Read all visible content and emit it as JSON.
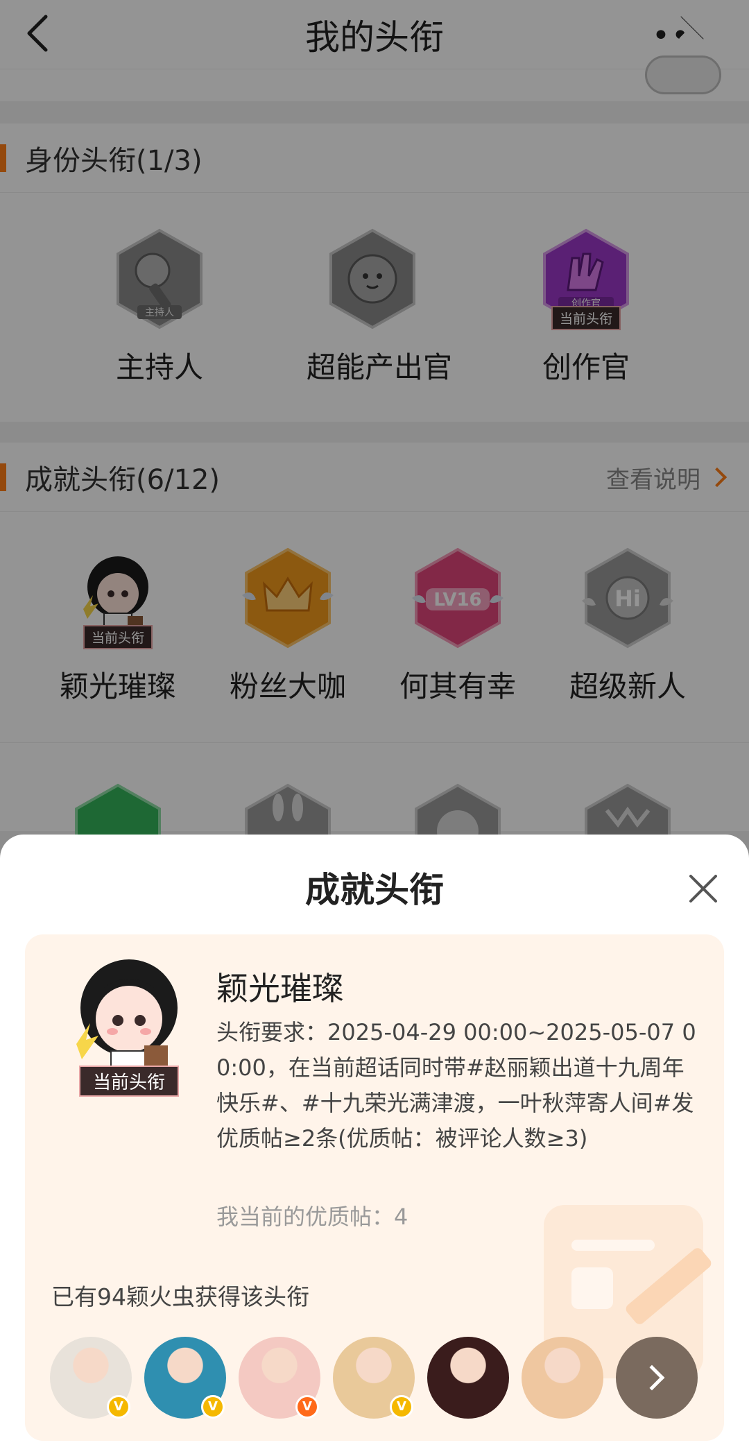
{
  "header": {
    "title": "我的头衔",
    "more_dots": "••"
  },
  "identity": {
    "title": "身份头衔(1/3)",
    "badges": [
      {
        "label": "主持人",
        "sub": "主持人",
        "icon": "microphone-badge-icon",
        "color": "#8a8a8a"
      },
      {
        "label": "超能产出官",
        "icon": "creature-badge-icon",
        "color": "#8a8a8a"
      },
      {
        "label": "创作官",
        "sub": "创作官",
        "icon": "hand-pen-badge-icon",
        "color": "#9b37c9",
        "current": "当前头衔"
      }
    ]
  },
  "achievement": {
    "title": "成就头衔(6/12)",
    "link": "查看说明",
    "badges": [
      {
        "label": "颖光璀璨",
        "icon": "cartoon-girl-avatar",
        "current": "当前头衔"
      },
      {
        "label": "粉丝大咖",
        "icon": "crown-badge-icon",
        "color": "#f29a1c"
      },
      {
        "label": "何其有幸",
        "text": "LV16",
        "icon": "lv16-badge-icon",
        "color": "#e0457b"
      },
      {
        "label": "超级新人",
        "text": "Hi",
        "icon": "hi-badge-icon",
        "color": "#9a9a9a"
      }
    ],
    "row2_icons": [
      "green-hand-badge-icon",
      "rabbit-badge-icon",
      "cartoon-head-badge-icon",
      "dragon-badge-icon"
    ]
  },
  "sheet": {
    "title": "成就头衔",
    "card": {
      "name": "颖光璀璨",
      "current": "当前头衔",
      "requirement": "头衔要求：2025-04-29 00:00~2025-05-07 00:00，在当前超话同时带#赵丽颖出道十九周年快乐#、#十九荣光满津渡，一叶秋萍寄人间#发优质帖≥2条(优质帖：被评论人数≥3)",
      "mine": "我当前的优质帖：4",
      "count": "已有94颖火虫获得该头衔"
    },
    "avatars": [
      {
        "name": "user-avatar-1",
        "badge": "V",
        "badge_color": "#f5b800",
        "bg": "#e8e2da"
      },
      {
        "name": "user-avatar-2",
        "badge": "V",
        "badge_color": "#f5b800",
        "bg": "#2f8fb0"
      },
      {
        "name": "user-avatar-3",
        "badge": "V",
        "badge_color": "#ff6a1a",
        "bg": "#f4c9c2"
      },
      {
        "name": "user-avatar-4",
        "badge": "V",
        "badge_color": "#f5b800",
        "bg": "#e9c99a"
      },
      {
        "name": "user-avatar-5",
        "bg": "#3a1c1c"
      },
      {
        "name": "user-avatar-6",
        "bg": "#efc7a0"
      },
      {
        "name": "user-avatar-7-more",
        "bg": "#7a6a5e"
      }
    ]
  }
}
